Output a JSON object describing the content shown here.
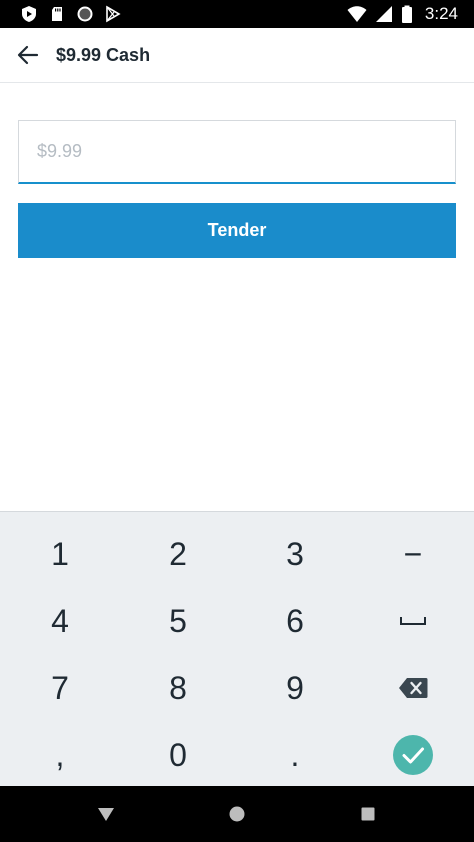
{
  "status_bar": {
    "time": "3:24",
    "left_icons": [
      "shield-icon",
      "sd-card-icon",
      "circle-icon",
      "play-store-icon"
    ],
    "right_icons": [
      "wifi-icon",
      "cell-signal-icon",
      "battery-icon"
    ]
  },
  "app_bar": {
    "title": "$9.99 Cash",
    "back_icon": "arrow-left-icon"
  },
  "amount_input": {
    "value": "",
    "placeholder": "$9.99"
  },
  "tender_button": {
    "label": "Tender"
  },
  "keypad": {
    "keys": [
      "1",
      "2",
      "3",
      "−",
      "4",
      "5",
      "6",
      "space",
      "7",
      "8",
      "9",
      "backspace",
      ",",
      "0",
      ".",
      "confirm"
    ],
    "digits": {
      "k1": "1",
      "k2": "2",
      "k3": "3",
      "k4": "4",
      "k5": "5",
      "k6": "6",
      "k7": "7",
      "k8": "8",
      "k9": "9",
      "k0": "0"
    },
    "minus": "−",
    "comma": ",",
    "period": ".",
    "confirm_color": "#4db6ac"
  },
  "nav_bar": {
    "buttons": [
      "back-triangle-icon",
      "home-circle-icon",
      "recents-square-icon"
    ]
  },
  "colors": {
    "accent": "#1a8ccb",
    "text": "#1f2a33",
    "keypad_bg": "#eceff2",
    "confirm": "#4db6ac"
  }
}
